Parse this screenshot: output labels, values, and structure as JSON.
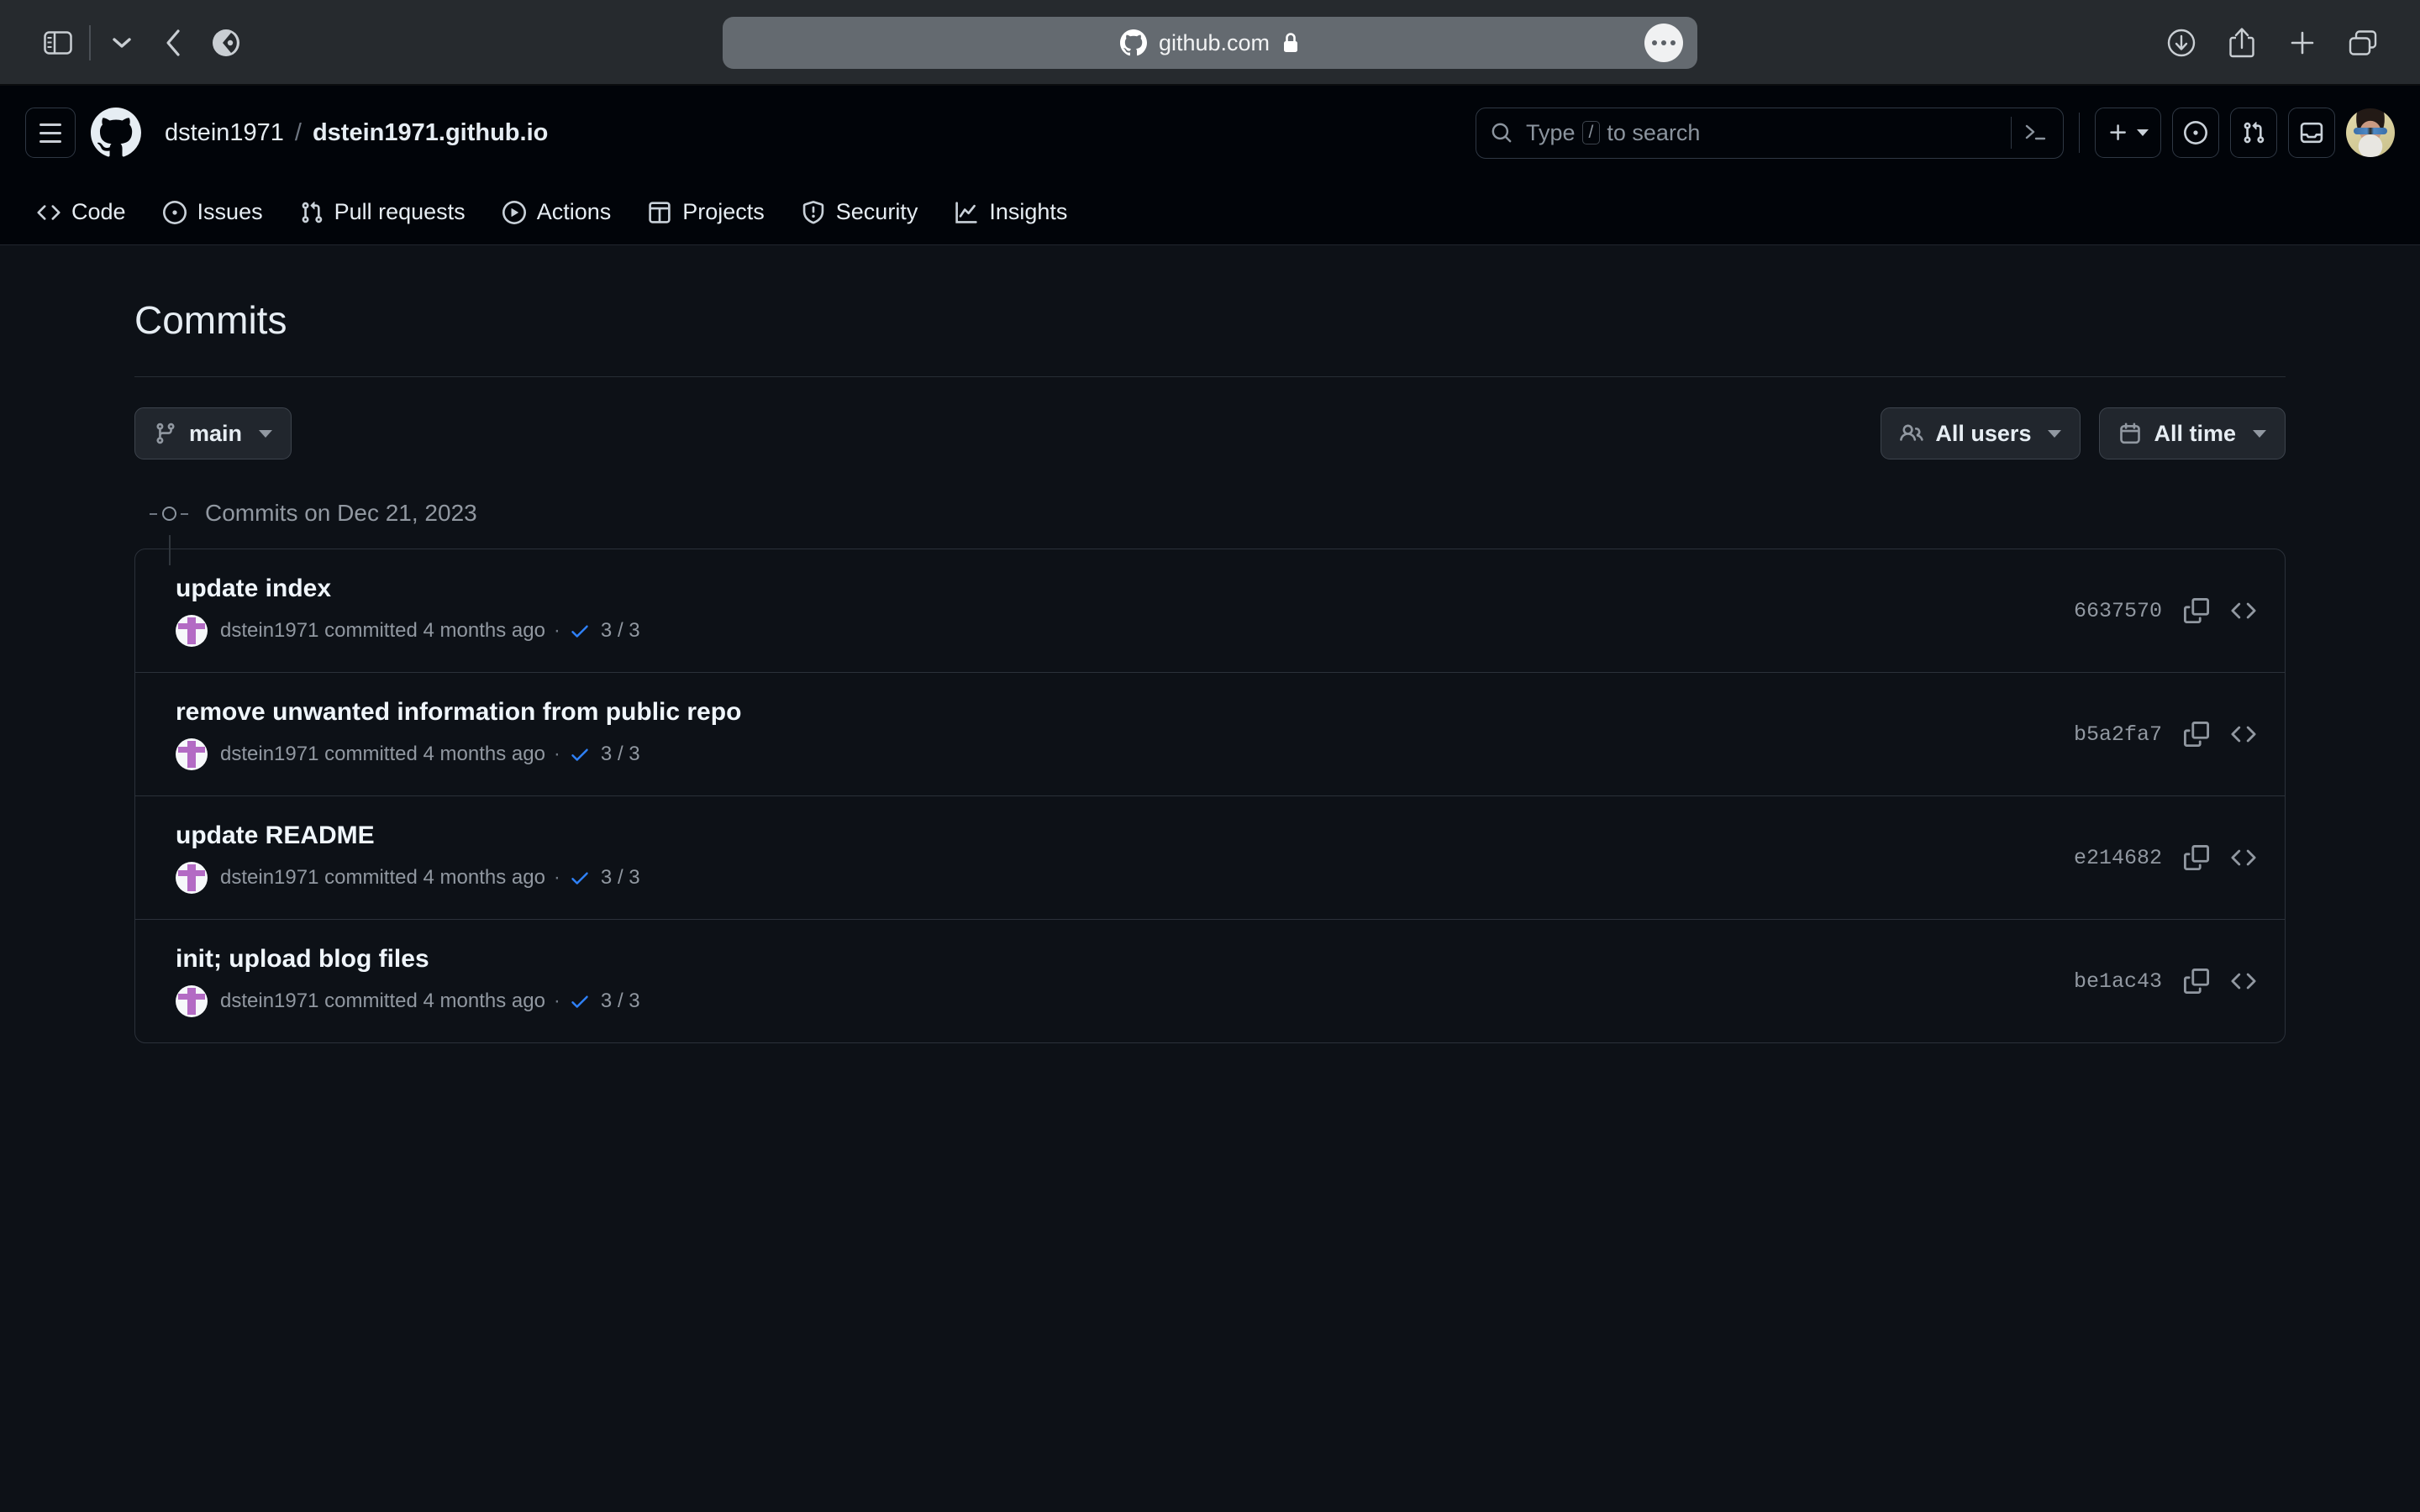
{
  "browser": {
    "url": "github.com",
    "lock_icon": "lock-icon",
    "sidebar_icon": "sidebar-toggle-icon",
    "tab_chevron_icon": "chevron-down-icon",
    "back_icon": "back-arrow-icon",
    "shield_icon": "privacy-report-icon",
    "page_menu_icon": "page-menu-icon",
    "downloads_icon": "downloads-icon",
    "share_icon": "share-icon",
    "new_tab_icon": "plus-icon",
    "tab_overview_icon": "tab-overview-icon"
  },
  "header": {
    "menu_icon": "hamburger-menu-icon",
    "logo_icon": "github-logo-icon",
    "owner": "dstein1971",
    "separator": "/",
    "repo": "dstein1971.github.io",
    "search": {
      "placeholder_before": "Type",
      "slash_key": "/",
      "placeholder_after": "to search",
      "search_icon": "search-icon",
      "terminal_icon": "command-palette-icon"
    },
    "create_label": "",
    "create_icon": "plus-icon",
    "create_caret_icon": "chevron-down-icon",
    "issues_icon": "issue-opened-icon",
    "pull_requests_icon": "git-pull-request-icon",
    "notifications_icon": "inbox-icon",
    "avatar": "user-avatar"
  },
  "nav": {
    "items": [
      {
        "label": "Code",
        "icon": "code-icon"
      },
      {
        "label": "Issues",
        "icon": "issue-opened-icon"
      },
      {
        "label": "Pull requests",
        "icon": "git-pull-request-icon"
      },
      {
        "label": "Actions",
        "icon": "play-icon"
      },
      {
        "label": "Projects",
        "icon": "table-icon"
      },
      {
        "label": "Security",
        "icon": "shield-icon"
      },
      {
        "label": "Insights",
        "icon": "graph-icon"
      }
    ]
  },
  "main": {
    "title": "Commits",
    "branch_button": {
      "label": "main",
      "icon": "git-branch-icon",
      "caret": "chevron-down-icon"
    },
    "filters": [
      {
        "label": "All users",
        "icon": "people-icon",
        "caret": "chevron-down-icon"
      },
      {
        "label": "All time",
        "icon": "calendar-icon",
        "caret": "chevron-down-icon"
      }
    ],
    "group_label": "Commits on Dec 21, 2023",
    "commits": [
      {
        "message": "update index",
        "author": "dstein1971",
        "action": "committed",
        "time": "4 months ago",
        "separator": "·",
        "verified_icon": "check-icon",
        "checks": "3 / 3",
        "sha": "6637570",
        "copy_icon": "copy-icon",
        "browse_icon": "code-icon"
      },
      {
        "message": "remove unwanted information from public repo",
        "author": "dstein1971",
        "action": "committed",
        "time": "4 months ago",
        "separator": "·",
        "verified_icon": "check-icon",
        "checks": "3 / 3",
        "sha": "b5a2fa7",
        "copy_icon": "copy-icon",
        "browse_icon": "code-icon"
      },
      {
        "message": "update README",
        "author": "dstein1971",
        "action": "committed",
        "time": "4 months ago",
        "separator": "·",
        "verified_icon": "check-icon",
        "checks": "3 / 3",
        "sha": "e214682",
        "copy_icon": "copy-icon",
        "browse_icon": "code-icon"
      },
      {
        "message": "init; upload blog files",
        "author": "dstein1971",
        "action": "committed",
        "time": "4 months ago",
        "separator": "·",
        "verified_icon": "check-icon",
        "checks": "3 / 3",
        "sha": "be1ac43",
        "copy_icon": "copy-icon",
        "browse_icon": "code-icon"
      }
    ]
  },
  "colors": {
    "page_bg": "#0d1117",
    "header_bg": "#010409",
    "border": "#2b313a",
    "text_primary": "#e6edf3",
    "text_muted": "#9198a1",
    "accent_blue": "#2f81f7",
    "identicon": "#b36bc4"
  }
}
